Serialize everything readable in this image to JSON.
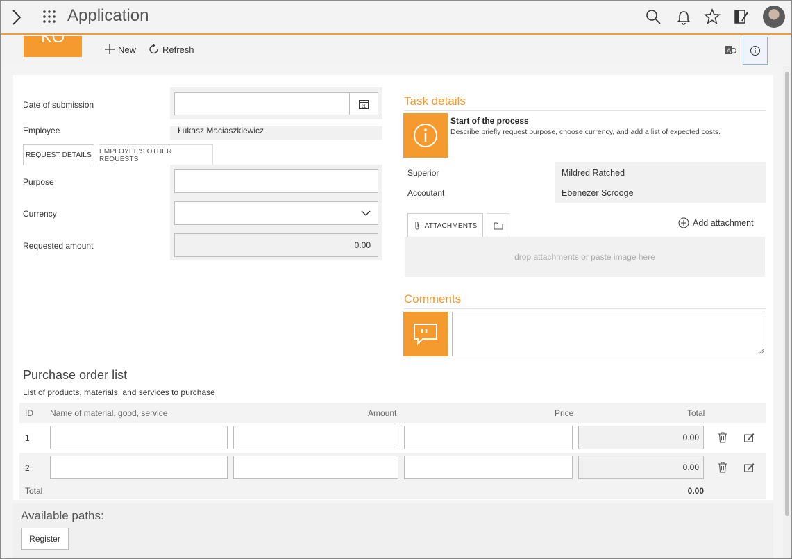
{
  "app": {
    "title": "Application",
    "logo_text": "KO"
  },
  "toolbar": {
    "new_label": "New",
    "refresh_label": "Refresh"
  },
  "form": {
    "date_label": "Date of submission",
    "date_value": "",
    "employee_label": "Employee",
    "employee_value": "Łukasz Maciaszkiewicz",
    "tabs": [
      {
        "label": "REQUEST DETAILS"
      },
      {
        "label": "EMPLOYEE'S OTHER REQUESTS"
      }
    ],
    "purpose_label": "Purpose",
    "purpose_value": "",
    "currency_label": "Currency",
    "currency_value": "",
    "requested_amount_label": "Requested amount",
    "requested_amount_value": "0.00"
  },
  "task": {
    "title": "Task details",
    "step_title": "Start of the process",
    "step_desc": "Describe briefly request purpose, choose currency, and add a list of expected costs.",
    "superior_label": "Superior",
    "superior_value": "Mildred Ratched",
    "accountant_label": "Accoutant",
    "accountant_value": "Ebenezer Scrooge",
    "attachments_tab": "ATTACHMENTS",
    "add_attachment": "Add attachment",
    "drop_text": "drop attachments or paste image here"
  },
  "comments": {
    "title": "Comments",
    "value": ""
  },
  "purchase": {
    "title": "Purchase order list",
    "subtitle": "List of products, materials, and services to purchase",
    "headers": {
      "id": "ID",
      "name": "Name of material, good, service",
      "amount": "Amount",
      "price": "Price",
      "total": "Total"
    },
    "rows": [
      {
        "id": "1",
        "total": "0.00"
      },
      {
        "id": "2",
        "total": "0.00"
      }
    ],
    "footer_label": "Total",
    "footer_total": "0.00"
  },
  "paths": {
    "title": "Available paths:",
    "register_label": "Register"
  },
  "colors": {
    "accent": "#f59a2e",
    "info_border": "#8cb0dc"
  }
}
